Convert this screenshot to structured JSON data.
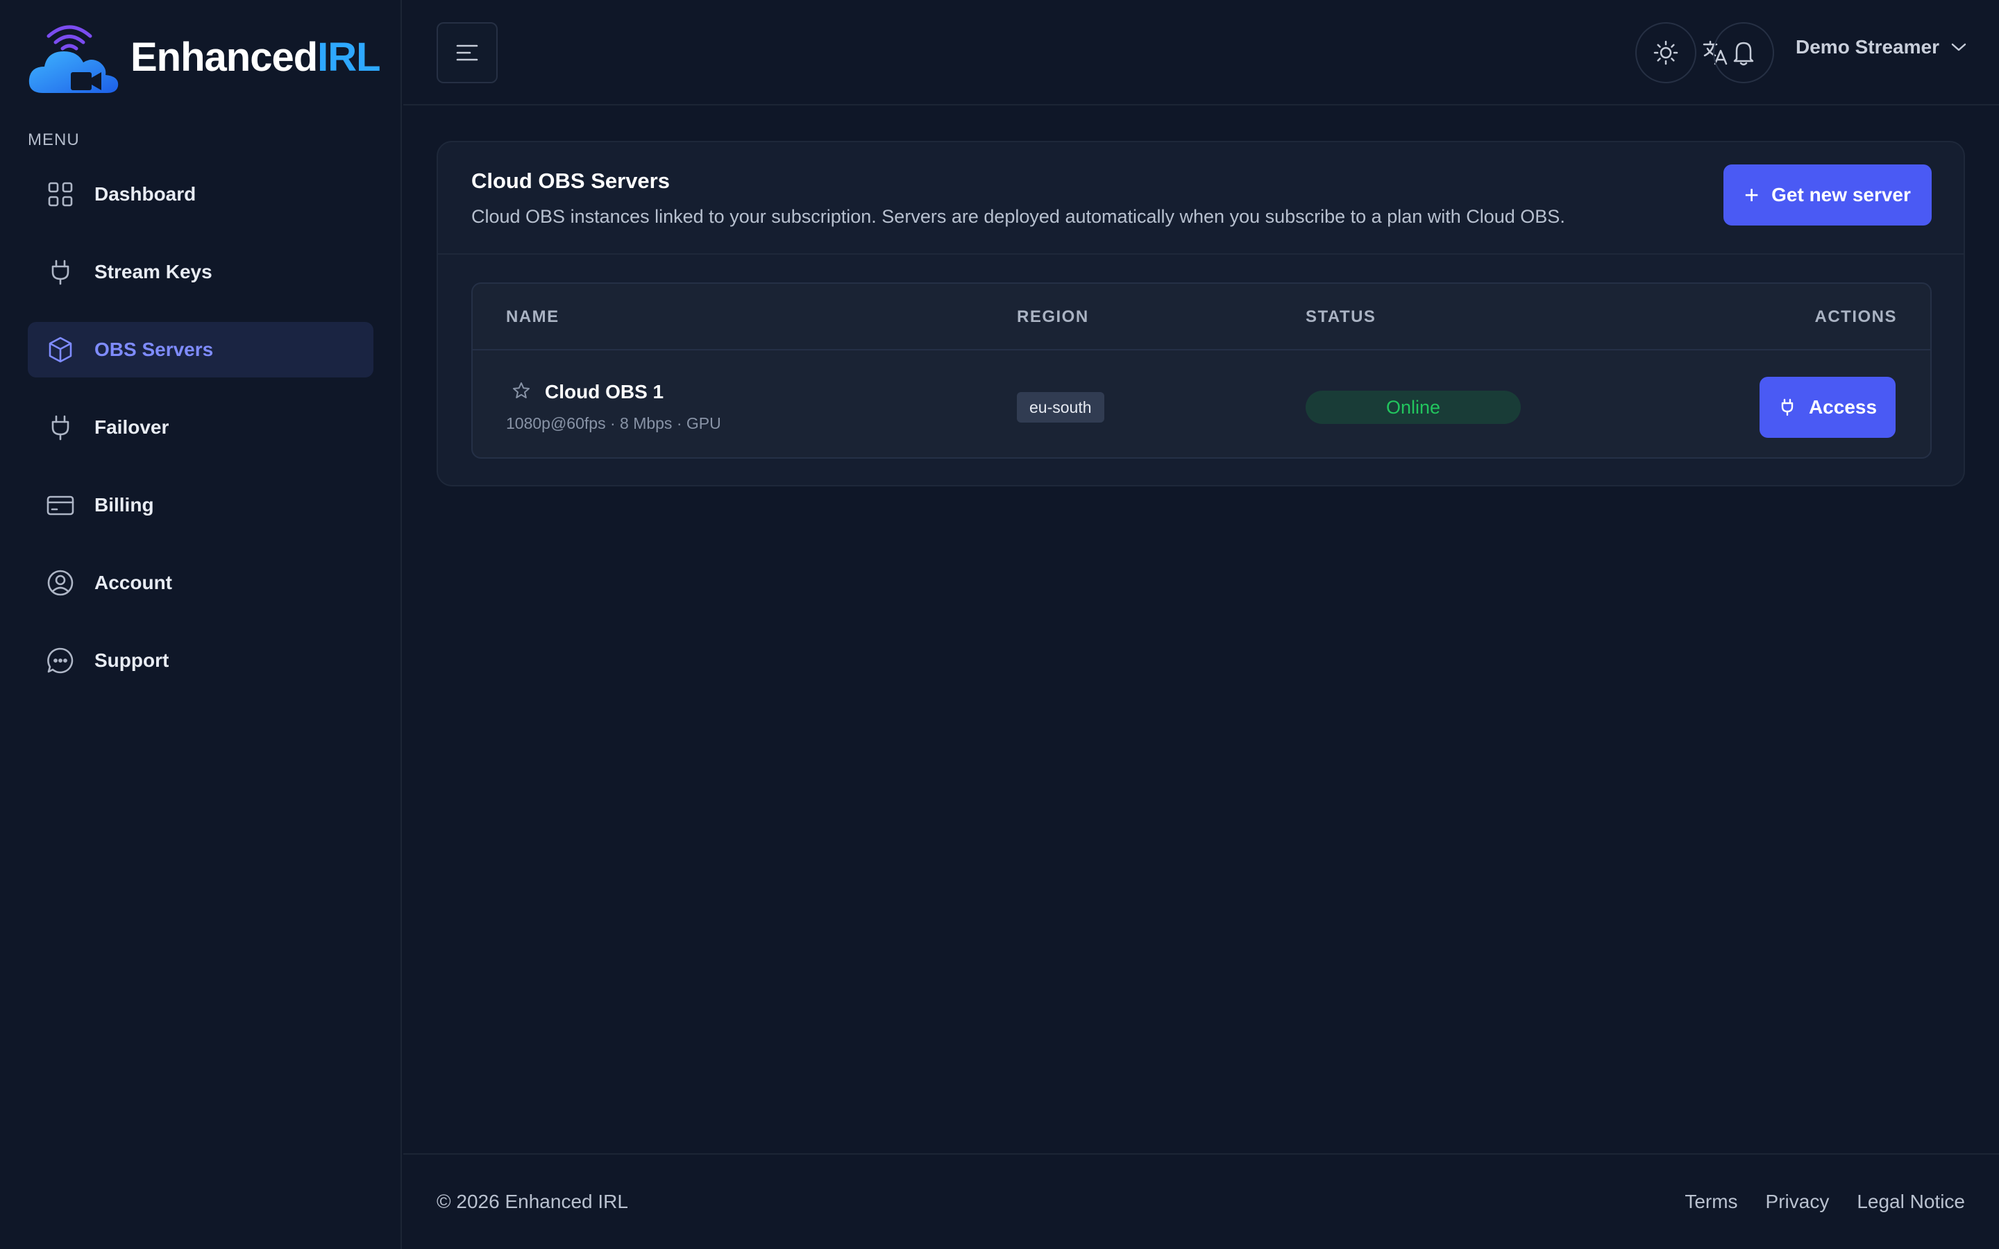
{
  "brand": {
    "name_part1": "Enhanced",
    "name_part2": "IRL",
    "primary_color": "#4a5af4",
    "accent_color": "#2ea8ff"
  },
  "sidebar": {
    "menu_label": "MENU",
    "items": [
      {
        "label": "Dashboard",
        "icon": "grid-icon",
        "active": false
      },
      {
        "label": "Stream Keys",
        "icon": "plug-icon",
        "active": false
      },
      {
        "label": "OBS Servers",
        "icon": "cube-icon",
        "active": true
      },
      {
        "label": "Failover",
        "icon": "plug-icon",
        "active": false
      },
      {
        "label": "Billing",
        "icon": "credit-card-icon",
        "active": false
      },
      {
        "label": "Account",
        "icon": "user-circle-icon",
        "active": false
      },
      {
        "label": "Support",
        "icon": "chat-bubble-icon",
        "active": false
      }
    ]
  },
  "header": {
    "icons": [
      "menu-icon",
      "translate-icon",
      "sun-icon",
      "bell-icon"
    ],
    "user_name": "Demo Streamer"
  },
  "main": {
    "card": {
      "title": "Cloud OBS Servers",
      "description": "Cloud OBS instances linked to your subscription. Servers are deployed automatically when you subscribe to a plan with Cloud OBS.",
      "new_server_label": "Get new server"
    },
    "table": {
      "columns": [
        "NAME",
        "REGION",
        "STATUS",
        "ACTIONS"
      ],
      "rows": [
        {
          "name": "Cloud OBS 1",
          "meta": "1080p@60fps · 8 Mbps · GPU",
          "region": "eu-south",
          "status": "Online",
          "action_label": "Access"
        }
      ]
    }
  },
  "footer": {
    "copyright": "© 2026 Enhanced IRL",
    "links": [
      "Terms",
      "Privacy",
      "Legal Notice"
    ]
  }
}
